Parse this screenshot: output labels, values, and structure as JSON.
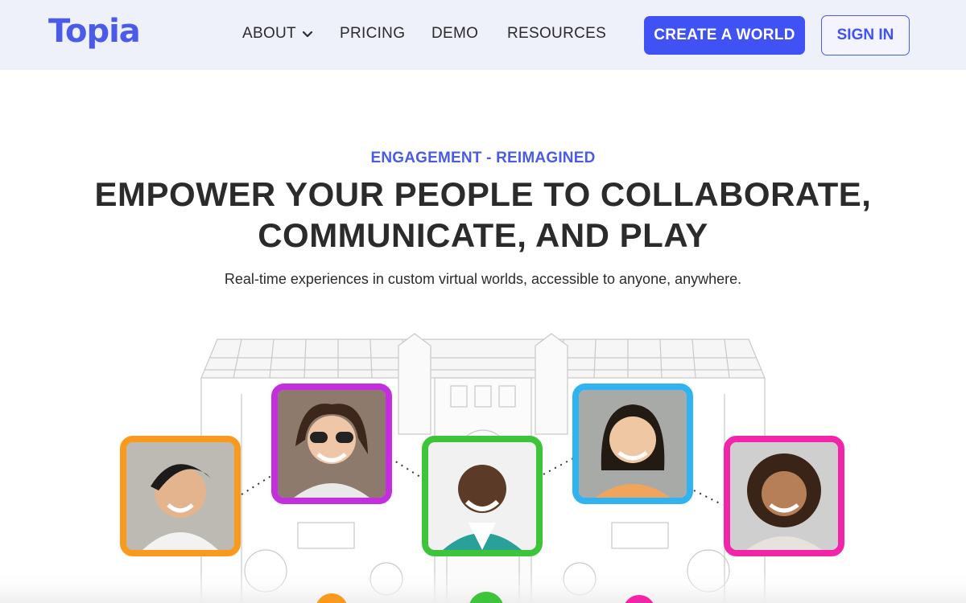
{
  "brand": {
    "logo_text": "Topia",
    "accent": "#4152f5"
  },
  "nav": {
    "about": "ABOUT",
    "pricing": "PRICING",
    "demo": "DEMO",
    "resources": "RESOURCES",
    "create_world": "CREATE A WORLD",
    "sign_in": "SIGN IN"
  },
  "hero": {
    "eyebrow": "ENGAGEMENT - REIMAGINED",
    "headline_line1": "EMPOWER YOUR PEOPLE TO COLLABORATE,",
    "headline_line2": "COMMUNICATE, AND PLAY",
    "subhead": "Real-time experiences in custom virtual worlds, accessible to anyone, anywhere."
  },
  "avatars": [
    {
      "name": "avatar-orange",
      "color": "#f99a1e"
    },
    {
      "name": "avatar-purple",
      "color": "#c52ee0"
    },
    {
      "name": "avatar-green",
      "color": "#3ec43a"
    },
    {
      "name": "avatar-blue",
      "color": "#2fb3f1"
    },
    {
      "name": "avatar-pink",
      "color": "#f225a8"
    }
  ]
}
